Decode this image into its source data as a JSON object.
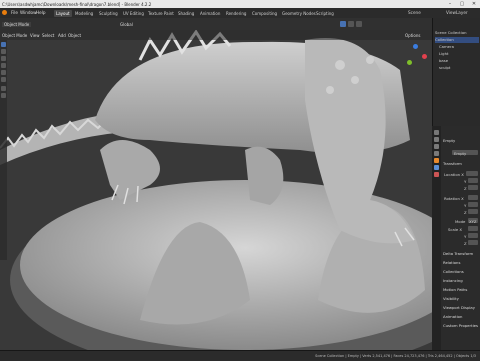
{
  "window": {
    "title": "C:\\Users\\asdwhjamc\\Downloads\\mesh-final\\dragon7.blend] - Blender 4.2.2",
    "controls": [
      "–",
      "▢",
      "✕"
    ]
  },
  "menu": {
    "items": [
      "File",
      "Window",
      "Help"
    ],
    "workspaces": [
      "Layout",
      "Modeling",
      "Sculpting",
      "UV Editing",
      "Texture Paint",
      "Shading",
      "Animation",
      "Rendering",
      "Compositing",
      "Geometry Nodes",
      "Scripting"
    ],
    "active_workspace": "Layout",
    "scene_label": "Scene",
    "view_layer_label": "ViewLayer"
  },
  "viewport_header": {
    "mode": "Object Mode",
    "view_menu": "View",
    "select_menu": "Select",
    "add_menu": "Add",
    "object_menu": "Object",
    "transform_orientation": "Global",
    "options_label": "Options"
  },
  "outliner": {
    "rows": [
      {
        "label": "Scene Collection",
        "selected": false
      },
      {
        "label": "Collection",
        "selected": true
      },
      {
        "label": "Camera",
        "selected": false
      },
      {
        "label": "Light",
        "selected": false
      },
      {
        "label": "base",
        "selected": false
      },
      {
        "label": "sculpt",
        "selected": false
      }
    ]
  },
  "properties": {
    "object_name": "Empty",
    "data_name": "Empty",
    "transform_header": "Transform",
    "location_label": "Location X",
    "axis_y": "Y",
    "axis_z": "Z",
    "rotation_label": "Rotation X",
    "mode_label": "Mode",
    "mode_value": "XYZ",
    "scale_label": "Scale X",
    "delta_header": "Delta Transform",
    "sections": [
      "Relations",
      "Collections",
      "Instancing",
      "Motion Paths",
      "Visibility",
      "Viewport Display",
      "Animation",
      "Custom Properties"
    ]
  },
  "statusbar": {
    "text": "Scene Collection | Empty | Verts 2,541,476 | Faces 24,723,476 | Tris 2,464,452 | Objects 1/3"
  },
  "colors": {
    "accent": "#4772b3",
    "selection": "#334d80",
    "background": "#3a3a3a",
    "sculpt": "#bdbdbd"
  }
}
